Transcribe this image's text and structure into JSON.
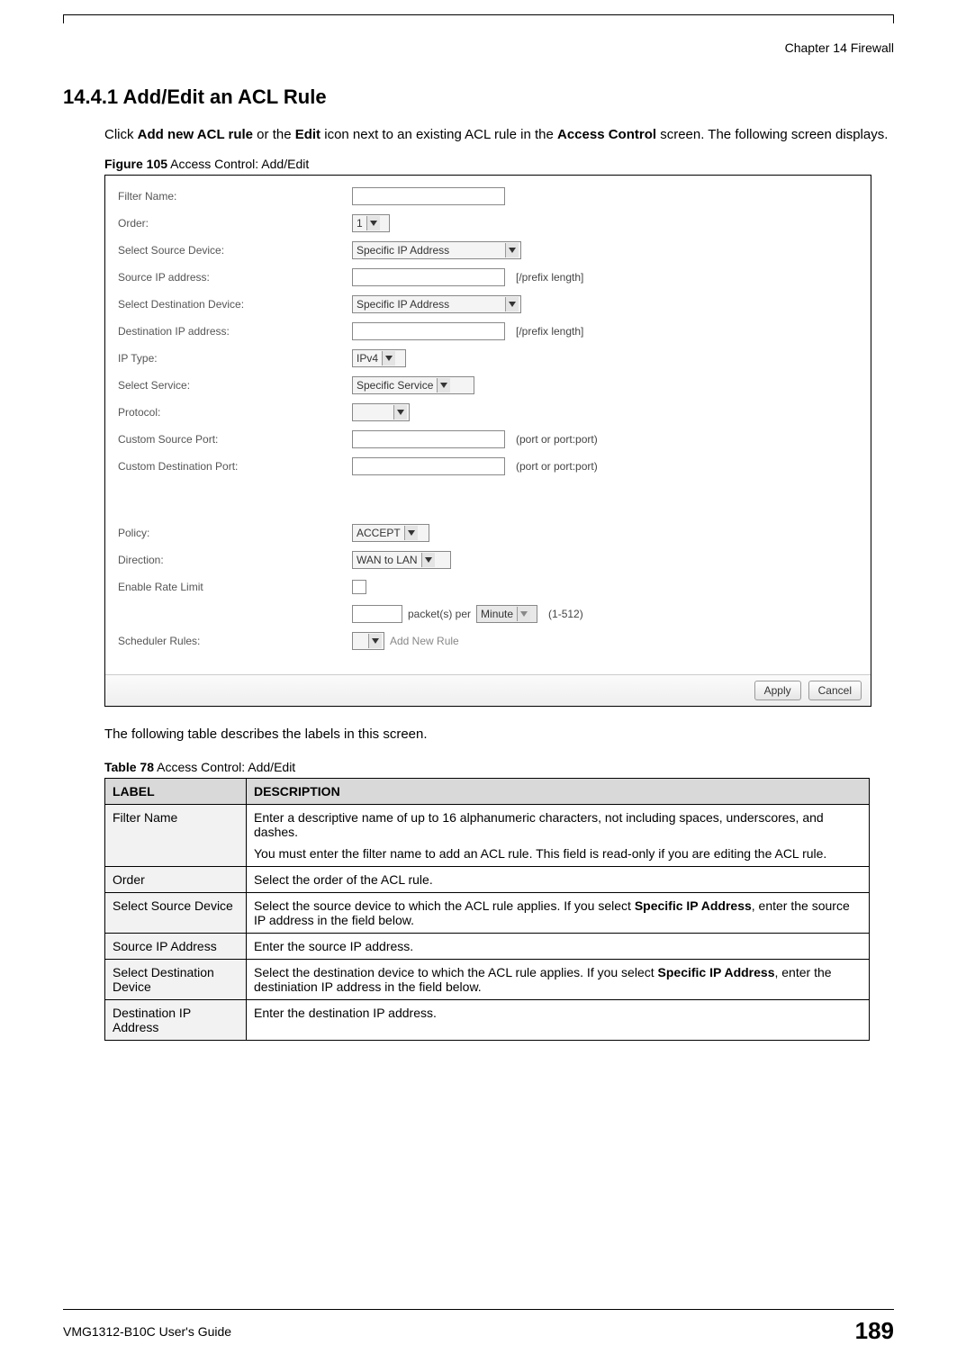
{
  "header": {
    "chapter": "Chapter 14 Firewall"
  },
  "section": {
    "title": "14.4.1  Add/Edit an ACL Rule"
  },
  "intro": {
    "pre": "Click ",
    "b1": "Add new ACL rule",
    "mid1": " or the ",
    "b2": "Edit",
    "mid2": " icon next to an existing ACL rule in the ",
    "b3": "Access Control",
    "post": " screen. The following screen displays."
  },
  "figure": {
    "label": "Figure 105",
    "title": "   Access Control: Add/Edit"
  },
  "form": {
    "filter_name": {
      "label": "Filter Name:"
    },
    "order": {
      "label": "Order:",
      "value": "1"
    },
    "src_dev": {
      "label": "Select Source Device:",
      "value": "Specific IP Address"
    },
    "src_ip": {
      "label": "Source IP address:",
      "suffix": "[/prefix length]"
    },
    "dst_dev": {
      "label": "Select Destination Device:",
      "value": "Specific IP Address"
    },
    "dst_ip": {
      "label": "Destination IP address:",
      "suffix": "[/prefix length]"
    },
    "ip_type": {
      "label": "IP Type:",
      "value": "IPv4"
    },
    "service": {
      "label": "Select Service:",
      "value": "Specific Service"
    },
    "protocol": {
      "label": "Protocol:"
    },
    "custom_src": {
      "label": "Custom Source Port:",
      "suffix": "(port or port:port)"
    },
    "custom_dst": {
      "label": "Custom Destination Port:",
      "suffix": "(port or port:port)"
    },
    "policy": {
      "label": "Policy:",
      "value": "ACCEPT"
    },
    "direction": {
      "label": "Direction:",
      "value": "WAN to LAN"
    },
    "rate_limit": {
      "label": "Enable Rate Limit"
    },
    "rate_line": {
      "mid": " packet(s) per ",
      "unit": "Minute",
      "suffix": " (1-512)"
    },
    "sched": {
      "label": "Scheduler Rules:",
      "link": "Add New Rule"
    },
    "buttons": {
      "apply": "Apply",
      "cancel": "Cancel"
    }
  },
  "after_fig": "The following table describes the labels in this screen.",
  "table_caption": {
    "label": "Table 78",
    "title": "   Access Control: Add/Edit"
  },
  "table": {
    "h_label": "LABEL",
    "h_desc": "DESCRIPTION",
    "rows": [
      {
        "label": "Filter Name",
        "desc": [
          "Enter a descriptive name of up to 16 alphanumeric characters, not including spaces, underscores, and dashes.",
          "You must enter the filter name to add an ACL rule. This field is read-only if you are editing the ACL rule."
        ]
      },
      {
        "label": "Order",
        "desc": [
          "Select the order of the ACL rule."
        ]
      },
      {
        "label": "Select Source Device",
        "desc_rich": {
          "pre": "Select the source device to which the ACL rule applies. If you select ",
          "bold": "Specific IP Address",
          "post": ", enter the source IP address in the field below."
        }
      },
      {
        "label": "Source IP Address",
        "desc": [
          "Enter the source IP address."
        ]
      },
      {
        "label": "Select Destination Device",
        "desc_rich": {
          "pre": "Select the destination device to which the ACL rule applies. If you select ",
          "bold": "Specific IP Address",
          "post": ", enter the destiniation IP address in the field below."
        }
      },
      {
        "label": "Destination IP Address",
        "desc": [
          "Enter the destination IP address."
        ]
      }
    ]
  },
  "footer": {
    "guide": "VMG1312-B10C User's Guide",
    "page": "189"
  }
}
